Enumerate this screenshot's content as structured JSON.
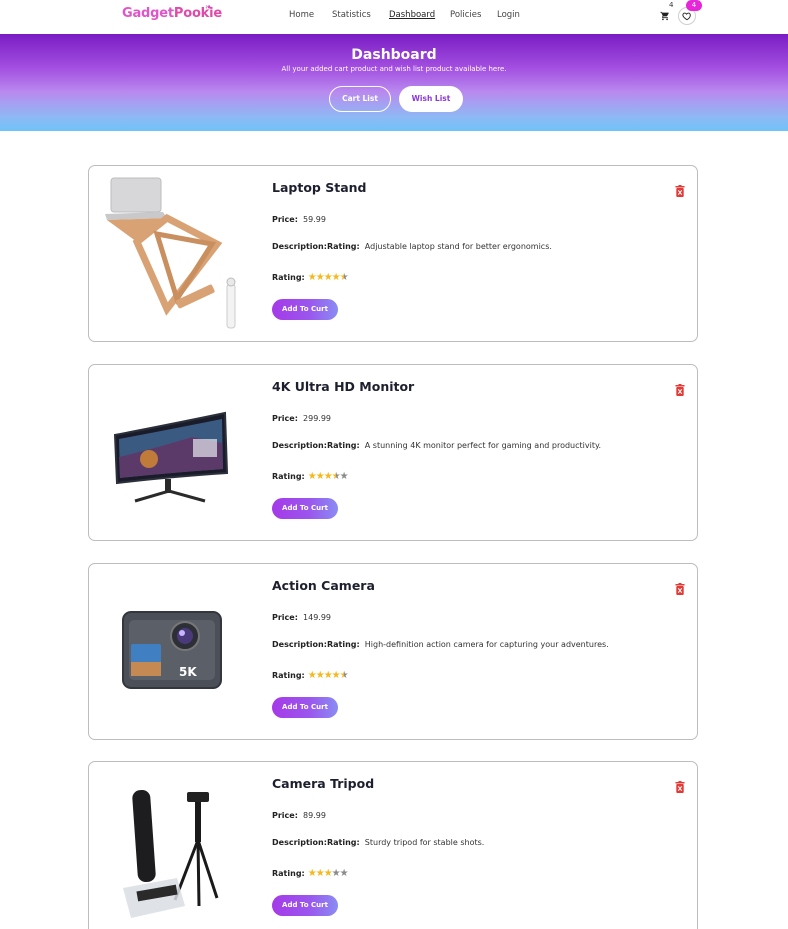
{
  "navbar": {
    "logo_part1": "Gadget",
    "logo_part2": "Pookie",
    "links": [
      "Home",
      "Statistics",
      "Dashboard",
      "Policies",
      "Login"
    ],
    "active_link": "Dashboard",
    "cart_count": "4",
    "wish_count": "4"
  },
  "banner": {
    "title": "Dashboard",
    "subtitle": "All your added cart product and wish list product available here.",
    "cart_button": "Cart List",
    "wish_button": "Wish List"
  },
  "labels": {
    "price": "Price:",
    "description": "Description:Rating:",
    "rating": "Rating:",
    "add_button": "Add To Curt"
  },
  "products": [
    {
      "title": "Laptop Stand",
      "price": "59.99",
      "description": "Adjustable laptop stand for better ergonomics.",
      "rating": 4.5
    },
    {
      "title": "4K Ultra HD Monitor",
      "price": "299.99",
      "description": "A stunning 4K monitor perfect for gaming and productivity.",
      "rating": 3.5
    },
    {
      "title": "Action Camera",
      "price": "149.99",
      "description": "High-definition action camera for capturing your adventures.",
      "rating": 4.5
    },
    {
      "title": "Camera Tripod",
      "price": "89.99",
      "description": "Sturdy tripod for stable shots.",
      "rating": 3
    }
  ],
  "colors": {
    "accent": "#a53ae8",
    "badge": "#e626d8",
    "delete": "#e53935",
    "star": "#f5b91e"
  }
}
